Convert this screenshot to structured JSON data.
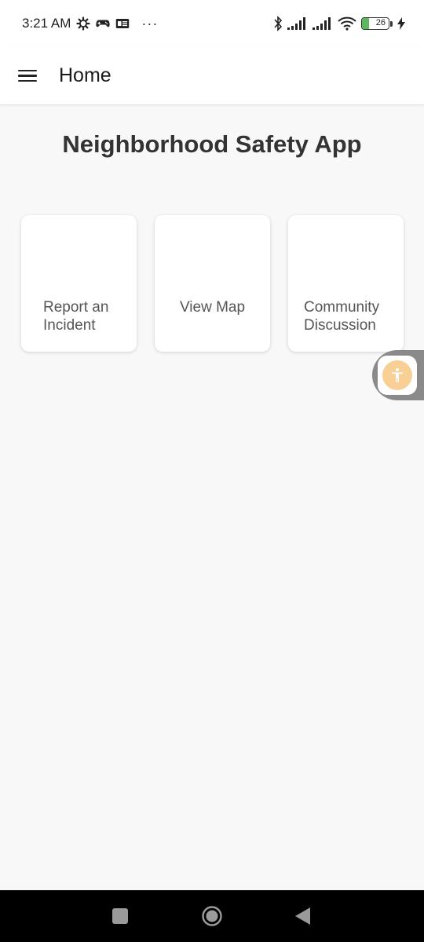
{
  "status_bar": {
    "time": "3:21 AM",
    "icons_left": [
      "gear-icon",
      "gamepad-icon",
      "news-icon"
    ],
    "more": "···",
    "icons_right": [
      "bluetooth-icon",
      "signal-icon",
      "signal-icon",
      "wifi-icon"
    ],
    "battery_level": "26",
    "charging": true
  },
  "app_bar": {
    "title": "Home",
    "menu_icon": "hamburger-menu-icon"
  },
  "main": {
    "title": "Neighborhood Safety App",
    "cards": [
      {
        "label": "Report an Incident"
      },
      {
        "label": "View Map"
      },
      {
        "label": "Community Discussion"
      }
    ]
  },
  "accessibility": {
    "icon": "accessibility-person-icon",
    "color": "#f8cf95"
  },
  "nav_bar": {
    "buttons": [
      "recents-square-icon",
      "home-circle-icon",
      "back-triangle-icon"
    ]
  },
  "colors": {
    "background": "#f8f8f8",
    "surface": "#ffffff",
    "text_primary": "#333333",
    "battery_green": "#5cb85c"
  }
}
